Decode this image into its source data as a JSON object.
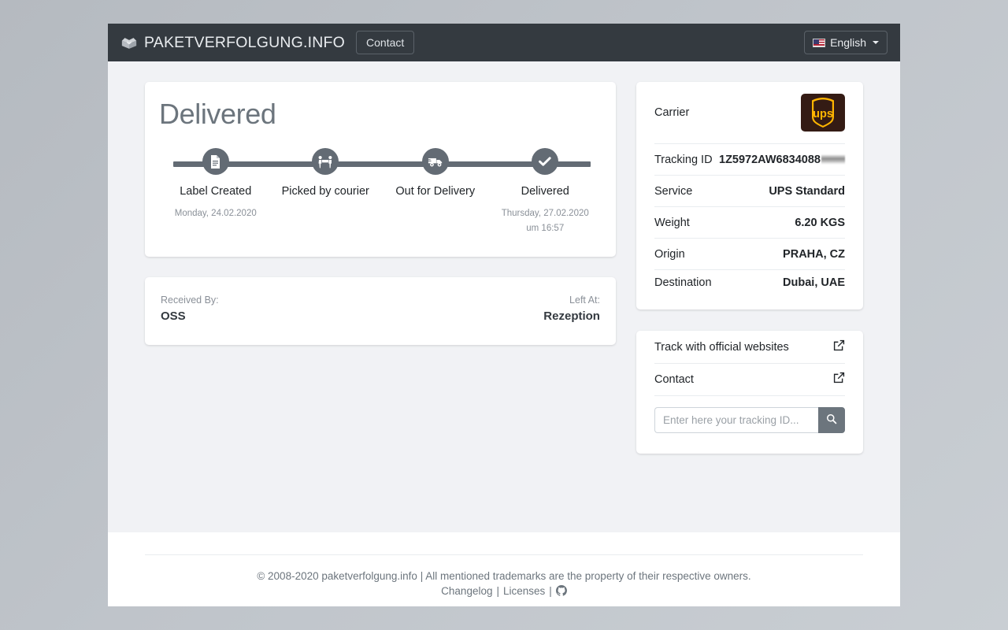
{
  "navbar": {
    "brand": "PAKETVERFOLGUNG.INFO",
    "brand_icon": "box-open-icon",
    "contact_label": "Contact",
    "language_label": "English",
    "language_flag": "us-flag-icon"
  },
  "status": {
    "title": "Delivered",
    "steps": [
      {
        "label": "Label Created",
        "icon": "file-document-icon",
        "date": "Monday, 24.02.2020",
        "time": ""
      },
      {
        "label": "Picked by courier",
        "icon": "people-carry-icon",
        "date": "",
        "time": ""
      },
      {
        "label": "Out for Delivery",
        "icon": "shipping-truck-icon",
        "date": "",
        "time": ""
      },
      {
        "label": "Delivered",
        "icon": "check-icon",
        "date": "Thursday, 27.02.2020",
        "time": "um 16:57"
      }
    ]
  },
  "received": {
    "received_by_label": "Received By:",
    "received_by_value": "OSS",
    "left_at_label": "Left At:",
    "left_at_value": "Rezeption"
  },
  "details": {
    "carrier_label": "Carrier",
    "carrier_logo": "ups-logo",
    "carrier_logo_text": "ups",
    "rows": [
      {
        "key": "Tracking ID",
        "value": "1Z5972AW6834088",
        "redacted": true
      },
      {
        "key": "Service",
        "value": "UPS Standard"
      },
      {
        "key": "Weight",
        "value": "6.20 KGS"
      },
      {
        "key": "Origin",
        "value": "PRAHA, CZ"
      },
      {
        "key": "Destination",
        "value": "Dubai, UAE"
      }
    ]
  },
  "links": {
    "items": [
      {
        "label": "Track with official websites",
        "icon": "external-link-icon"
      },
      {
        "label": "Contact",
        "icon": "external-link-icon"
      }
    ],
    "search_placeholder": "Enter here your tracking ID...",
    "search_value": "",
    "search_icon": "search-icon"
  },
  "footer": {
    "line1": "© 2008-2020 paketverfolgung.info | All mentioned trademarks are the property of their respective owners.",
    "changelog": "Changelog",
    "separator1": "|",
    "licenses": "Licenses",
    "separator2": "|",
    "github_icon": "github-icon"
  },
  "colors": {
    "navbar": "#343a40",
    "timeline": "#636b74",
    "ups_brown": "#341b14",
    "ups_gold": "#ffb500",
    "page_bg": "#f1f2f5"
  }
}
